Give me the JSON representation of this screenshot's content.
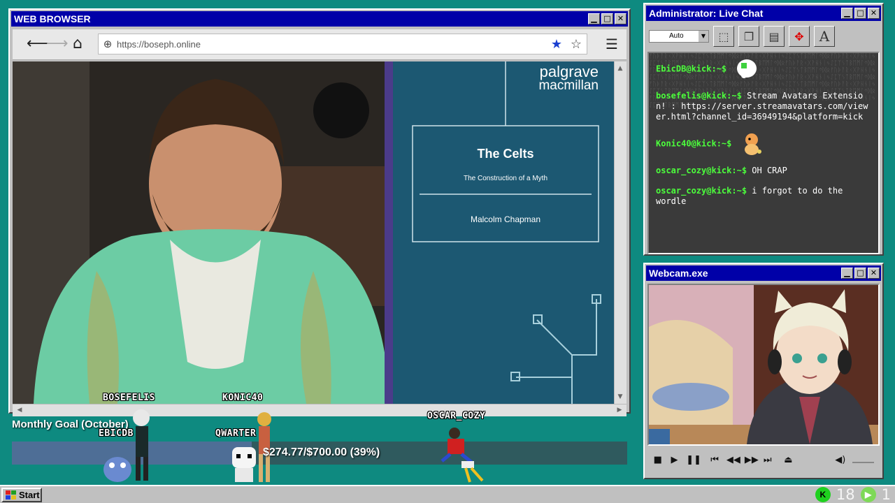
{
  "browser": {
    "title": "WEB BROWSER",
    "url": "https://boseph.online",
    "controls": {
      "minimize": "▁",
      "maximize": "□",
      "close": "✕"
    },
    "book": {
      "publisher_line1": "palgrave",
      "publisher_line2": "macmillan",
      "title": "The Celts",
      "subtitle": "The Construction of a Myth",
      "author": "Malcolm Chapman"
    }
  },
  "chat": {
    "title": "Administrator: Live Chat",
    "mode": "Auto",
    "messages": [
      {
        "user": "EbicDB@kick:~$",
        "text": ""
      },
      {
        "user": "bosefelis@kick:~$",
        "text": "Stream Avatars Extension! : https://server.streamavatars.com/viewer.html?channel_id=36949194&platform=kick"
      },
      {
        "user": "Konic40@kick:~$",
        "text": ""
      },
      {
        "user": "oscar_cozy@kick:~$",
        "text": "OH CRAP"
      },
      {
        "user": "oscar_cozy@kick:~$",
        "text": "i forgot to do the wordle"
      }
    ]
  },
  "webcam": {
    "title": "Webcam.exe"
  },
  "goal": {
    "title": "Monthly Goal (October)",
    "amount_text": "$274.77/$700.00 (39%)",
    "progress": 0.39
  },
  "avatars": [
    "BOSEFELIS",
    "KONIC40",
    "EBICDB",
    "QWARTER",
    "OSCAR_COZY"
  ],
  "taskbar": {
    "start_label": "Start",
    "count_a": "18",
    "count_b": "1"
  }
}
